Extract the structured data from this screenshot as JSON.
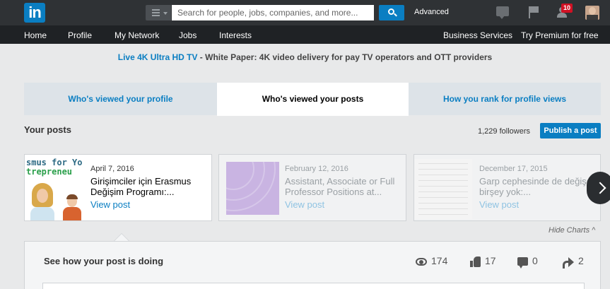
{
  "topbar": {
    "logo": "in",
    "search_placeholder": "Search for people, jobs, companies, and more...",
    "advanced_label": "Advanced",
    "notifications_count": "10"
  },
  "nav": {
    "items": [
      "Home",
      "Profile",
      "My Network",
      "Jobs",
      "Interests"
    ],
    "business_services": "Business Services",
    "premium": "Try Premium for free"
  },
  "ad": {
    "link_text": "Live 4K Ultra HD TV",
    "rest_text": " - White Paper: 4K video delivery for pay TV operators and OTT providers"
  },
  "tabs": [
    {
      "label": "Who's viewed your profile",
      "active": false
    },
    {
      "label": "Who's viewed your posts",
      "active": true
    },
    {
      "label": "How you rank for profile views",
      "active": false
    }
  ],
  "posts_section": {
    "title": "Your posts",
    "followers": "1,229 followers",
    "publish_label": "Publish a post"
  },
  "posts": [
    {
      "thumb_line1": "smus for Yo",
      "thumb_line2": "trepreneu",
      "date": "April 7, 2016",
      "title": "Girişimciler için Erasmus Değişim Programı:...",
      "link": "View post"
    },
    {
      "date": "February 12, 2016",
      "title": "Assistant, Associate or Full Professor Positions at...",
      "link": "View post"
    },
    {
      "date": "December 17, 2015",
      "title": "Garp cephesinde de değişen birşey yok:...",
      "link": "View post"
    }
  ],
  "hide_charts": "Hide Charts ^",
  "stats_panel": {
    "title": "See how your post is doing",
    "views": "174",
    "likes": "17",
    "comments": "0",
    "shares": "2"
  },
  "colors": {
    "brand_blue": "#0a7ec2",
    "topbar": "#2f3235",
    "navbar": "#1f2225",
    "page_bg": "#e8e9ea"
  }
}
